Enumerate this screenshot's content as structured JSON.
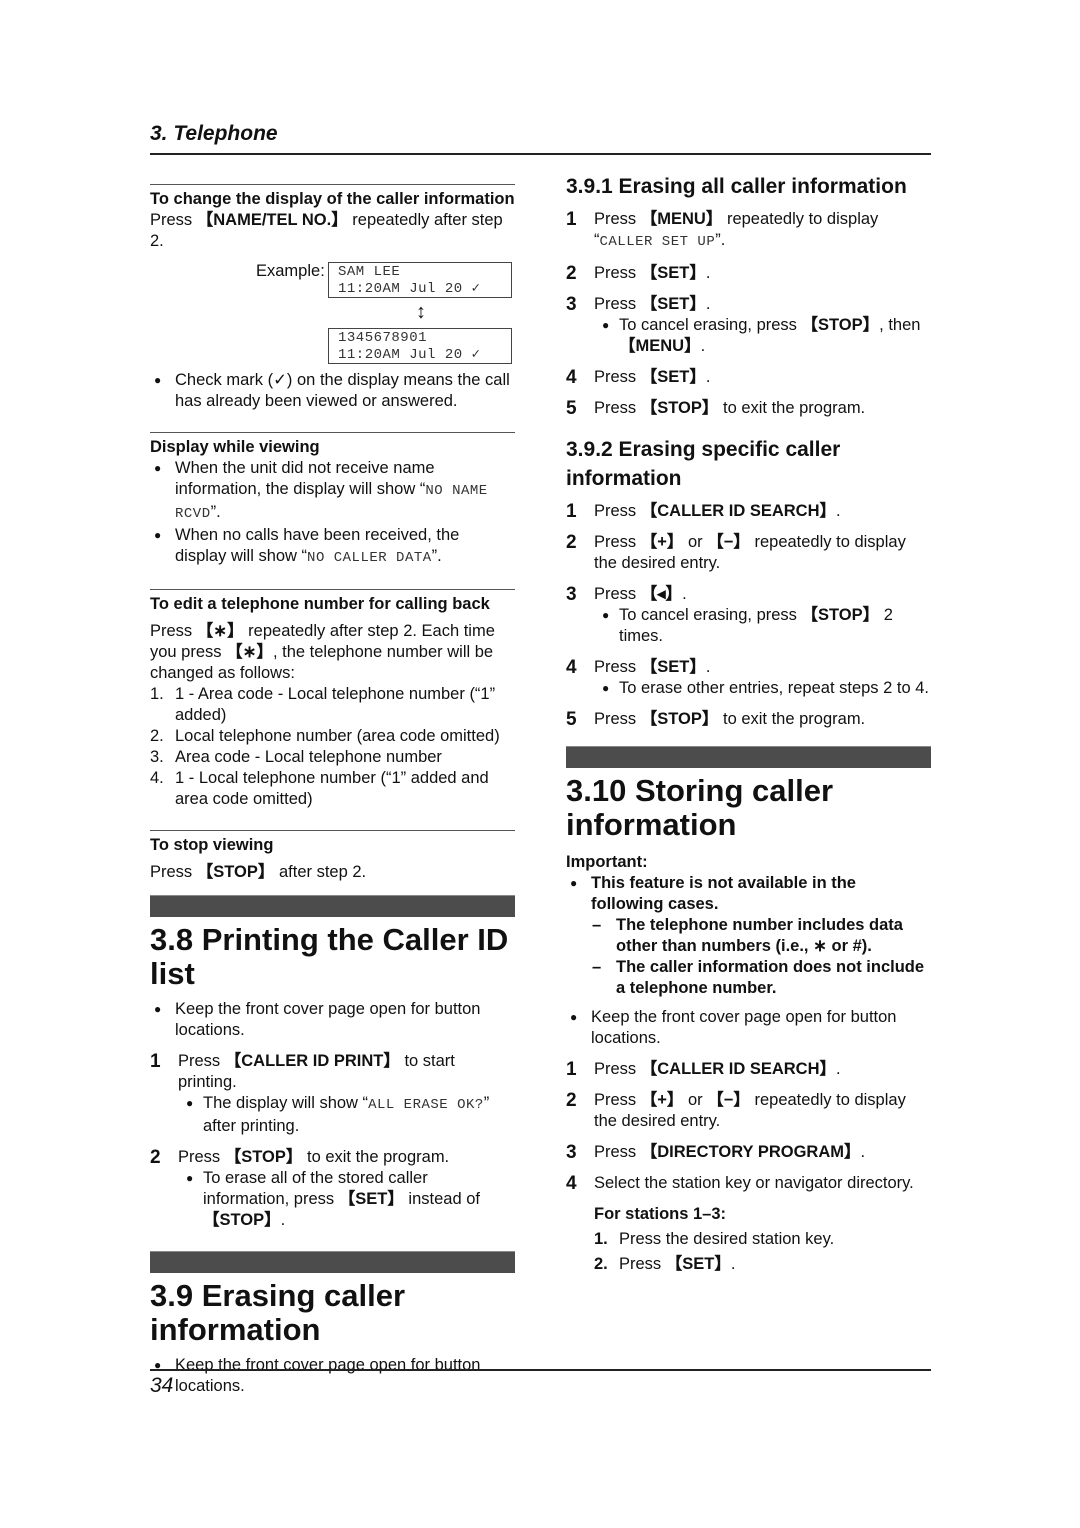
{
  "header": {
    "chapter": "3. Telephone"
  },
  "footer": {
    "page_number": "34"
  },
  "left": {
    "change_display": {
      "heading": "To change the display of the caller information",
      "text_pre": "Press ",
      "key": "【NAME/TEL NO.】",
      "text_post": " repeatedly after step 2.",
      "example_label": "Example:",
      "lcd1": [
        "SAM LEE",
        "11:20AM Jul 20 ✓"
      ],
      "lcd2": [
        "1345678901",
        "11:20AM Jul 20 ✓"
      ],
      "arrow_icon": "↕",
      "note": "Check mark (✓) on the display means the call has already been viewed or answered."
    },
    "display_viewing": {
      "heading": "Display while viewing",
      "b1_pre": "When the unit did not receive name information, the display will show “",
      "b1_mono": "NO NAME RCVD",
      "b1_post": "”.",
      "b2_pre": "When no calls have been received, the display will show “",
      "b2_mono": "NO CALLER DATA",
      "b2_post": "”."
    },
    "edit_number": {
      "heading": "To edit a telephone number for calling back",
      "p1": "Press ",
      "key_star": "【∗】",
      "p2": " repeatedly after step 2. Each time you press ",
      "p3": ", the telephone number will be changed as follows:",
      "items": [
        {
          "n": "1.",
          "text": "1 - Area code - Local telephone number (“1” added)"
        },
        {
          "n": "2.",
          "text": "Local telephone number (area code omitted)"
        },
        {
          "n": "3.",
          "text": "Area code - Local telephone number"
        },
        {
          "n": "4.",
          "text": "1 - Local telephone number (“1” added and area code omitted)"
        }
      ]
    },
    "stop_viewing": {
      "heading": "To stop viewing",
      "pre": "Press ",
      "key": "【STOP】",
      "post": " after step 2."
    },
    "sec38": {
      "title": "3.8 Printing the Caller ID list",
      "bullet": "Keep the front cover page open for button locations.",
      "s1_pre": "Press ",
      "s1_key": "【CALLER ID PRINT】",
      "s1_post": " to start printing.",
      "s1_sub_pre": "The display will show “",
      "s1_sub_mono": "ALL ERASE OK?",
      "s1_sub_post": "” after printing.",
      "s2_pre": "Press ",
      "s2_key": "【STOP】",
      "s2_post": " to exit the program.",
      "s2_sub_pre": "To erase all of the stored caller information, press ",
      "s2_sub_key1": "【SET】",
      "s2_sub_mid": " instead of ",
      "s2_sub_key2": "【STOP】",
      "s2_sub_post": "."
    },
    "sec39": {
      "title": "3.9 Erasing caller information",
      "bullet": "Keep the front cover page open for button locations."
    }
  },
  "right": {
    "sec391": {
      "title": "3.9.1 Erasing all caller information",
      "s1_pre": "Press ",
      "s1_key": "【MENU】",
      "s1_post": " repeatedly to display ",
      "s1_open": "“",
      "s1_mono": "CALLER SET UP",
      "s1_close": "”.",
      "s2_pre": "Press ",
      "s2_key": "【SET】",
      "s2_post": ".",
      "s3_pre": "Press ",
      "s3_key": "【SET】",
      "s3_post": ".",
      "s3_sub_pre": "To cancel erasing, press ",
      "s3_sub_key1": "【STOP】",
      "s3_sub_mid": ", then ",
      "s3_sub_key2": "【MENU】",
      "s3_sub_post": ".",
      "s4_pre": "Press ",
      "s4_key": "【SET】",
      "s4_post": ".",
      "s5_pre": "Press ",
      "s5_key": "【STOP】",
      "s5_post": " to exit the program."
    },
    "sec392": {
      "title": "3.9.2 Erasing specific caller information",
      "s1_pre": "Press ",
      "s1_key": "【CALLER ID SEARCH】",
      "s1_post": ".",
      "s2_pre": "Press ",
      "s2_key1": "【+】",
      "s2_mid": " or ",
      "s2_key2": "【−】",
      "s2_post": " repeatedly to display the desired entry.",
      "s3_pre": "Press ",
      "s3_key": "【◂】",
      "s3_post": ".",
      "s3_sub_pre": "To cancel erasing, press ",
      "s3_sub_key": "【STOP】",
      "s3_sub_post": " 2 times.",
      "s4_pre": "Press ",
      "s4_key": "【SET】",
      "s4_post": ".",
      "s4_sub": "To erase other entries, repeat steps 2 to 4.",
      "s5_pre": "Press ",
      "s5_key": "【STOP】",
      "s5_post": " to exit the program."
    },
    "sec310": {
      "title": "3.10 Storing caller information",
      "important": "Important:",
      "imp_bullet": "This feature is not available in the following cases.",
      "dash1": "The telephone number includes data other than numbers (i.e., ∗ or #).",
      "dash2": "The caller information does not include a telephone number.",
      "bullet": "Keep the front cover page open for button locations.",
      "s1_pre": "Press ",
      "s1_key": "【CALLER ID SEARCH】",
      "s1_post": ".",
      "s2_pre": "Press ",
      "s2_key1": "【+】",
      "s2_mid": " or ",
      "s2_key2": "【−】",
      "s2_post": " repeatedly to display the desired entry.",
      "s3_pre": "Press ",
      "s3_key": "【DIRECTORY PROGRAM】",
      "s3_post": ".",
      "s4": "Select the station key or navigator directory.",
      "stations_head": "For stations 1–3:",
      "st1_n": "1.",
      "st1": "Press the desired station key.",
      "st2_n": "2.",
      "st2_pre": "Press ",
      "st2_key": "【SET】",
      "st2_post": "."
    }
  },
  "steps": [
    "1",
    "2",
    "3",
    "4",
    "5"
  ]
}
